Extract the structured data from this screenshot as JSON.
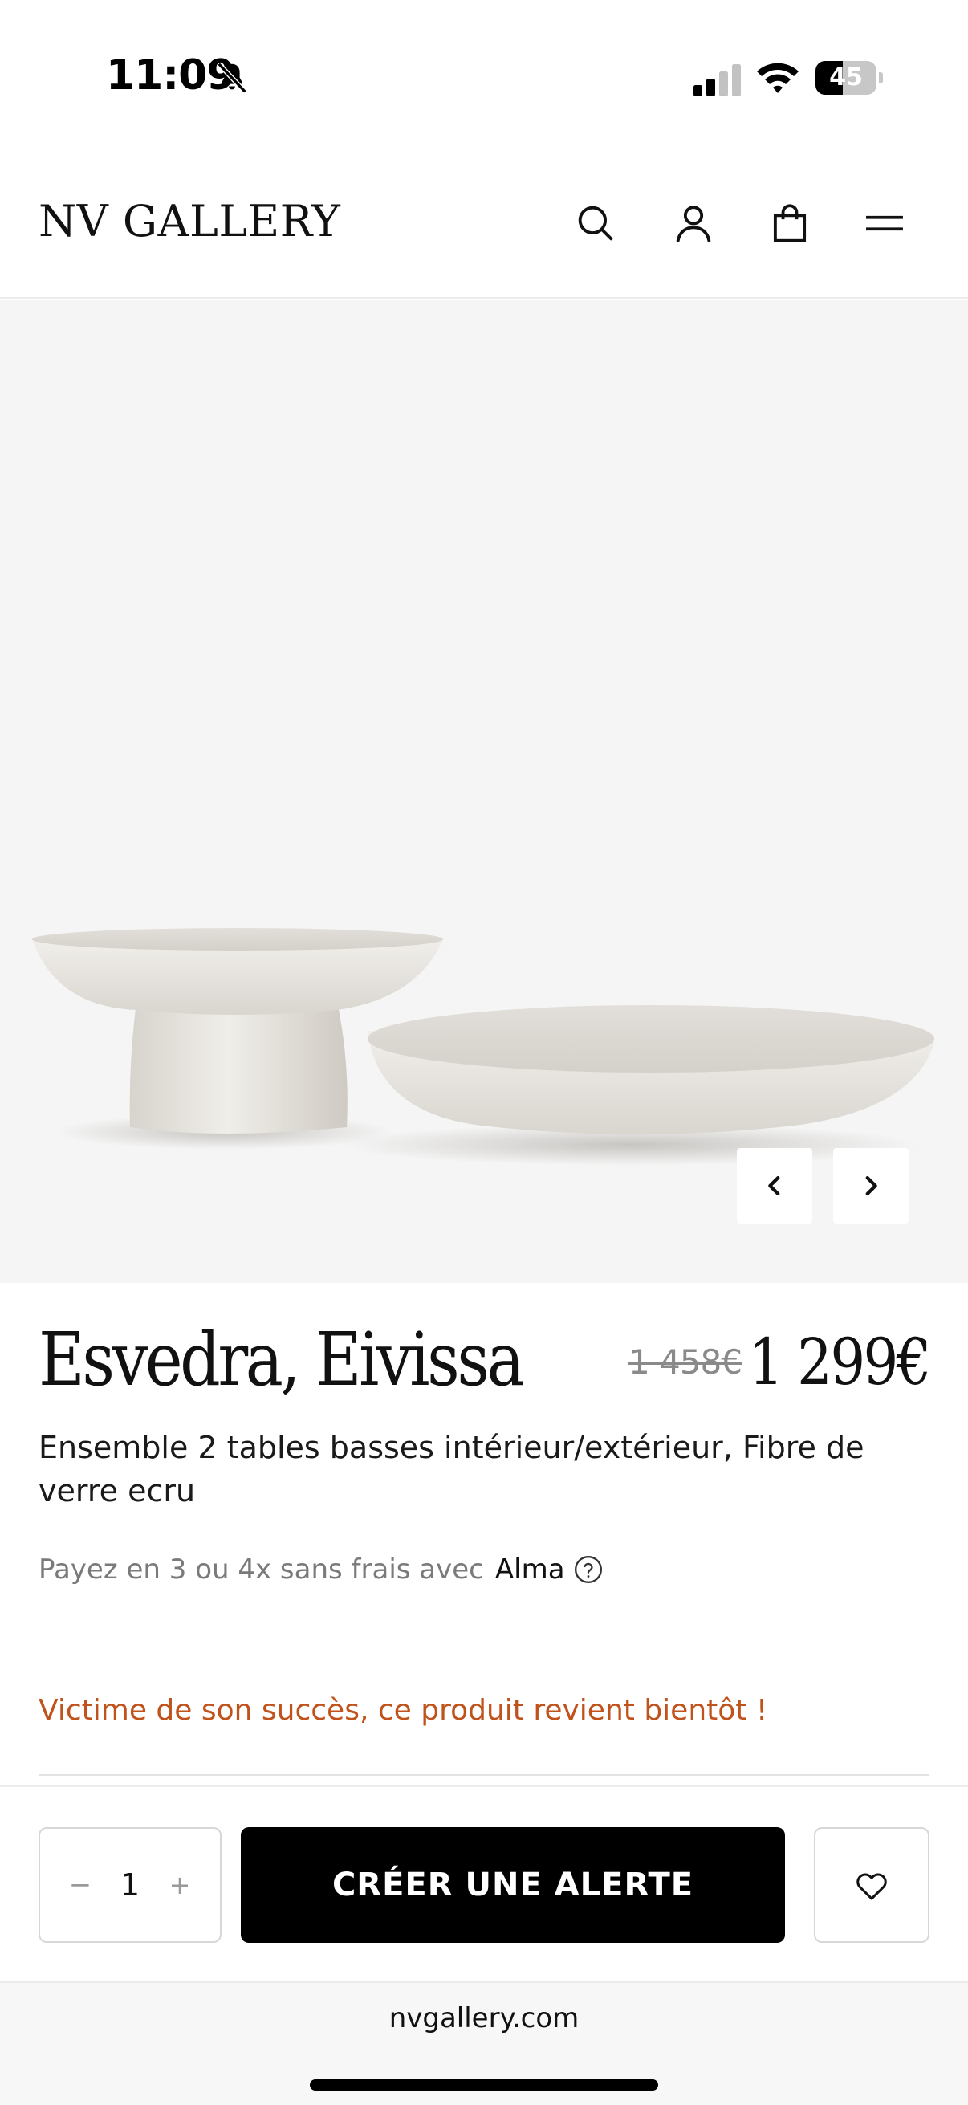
{
  "status_bar": {
    "time": "11:09",
    "battery_level": "45",
    "battery_fraction": 0.45
  },
  "header": {
    "logo": "NV GALLERY",
    "icons": [
      "search-icon",
      "account-icon",
      "cart-icon",
      "menu-icon"
    ]
  },
  "gallery": {
    "image_alt": "Deux tables basses rondes en fibre de verre ecru",
    "prev_icon": "chevron-left-icon",
    "next_icon": "chevron-right-icon"
  },
  "product": {
    "title": "Esvedra, Eivissa",
    "price_old": "1 458€",
    "price_new": "1 299€",
    "subtitle": "Ensemble 2 tables basses intérieur/extérieur, Fibre de verre ecru",
    "payment_text": "Payez en 3 ou 4x sans frais avec",
    "payment_brand": "Alma",
    "stock_message": "Victime de son succès, ce produit revient bientôt !"
  },
  "actions": {
    "qty_minus": "−",
    "qty_value": "1",
    "qty_plus": "+",
    "alert_label": "CRÉER UNE ALERTE",
    "wishlist_icon": "heart-icon"
  },
  "browser": {
    "url": "nvgallery.com"
  },
  "colors": {
    "accent_warning": "#c0521b",
    "cta_background": "#000000",
    "gallery_background": "#f5f5f5"
  }
}
